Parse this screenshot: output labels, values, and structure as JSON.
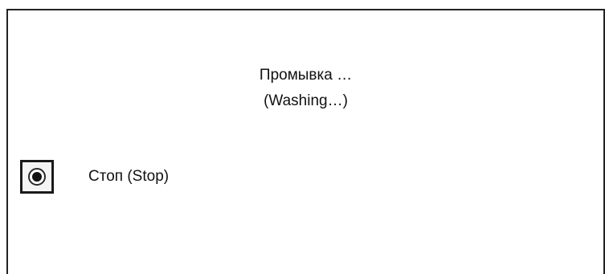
{
  "status": {
    "line1": "Промывка …",
    "line2": "(Washing…)"
  },
  "stop": {
    "label": "Стоп (Stop)",
    "icon": "radio-selected-icon",
    "checked": true
  }
}
